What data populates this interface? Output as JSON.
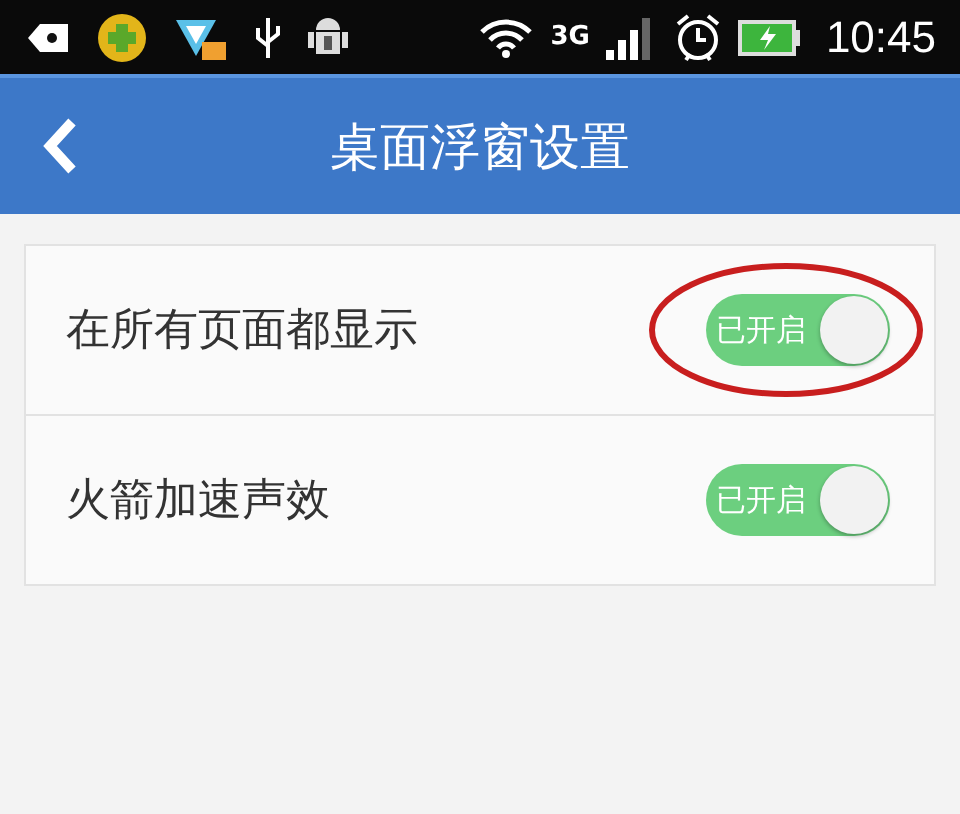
{
  "status_bar": {
    "network": "3G",
    "time": "10:45"
  },
  "header": {
    "title": "桌面浮窗设置"
  },
  "settings": [
    {
      "label": "在所有页面都显示",
      "on": true,
      "state_label": "已开启",
      "circled": true
    },
    {
      "label": "火箭加速声效",
      "on": true,
      "state_label": "已开启",
      "circled": false
    }
  ]
}
